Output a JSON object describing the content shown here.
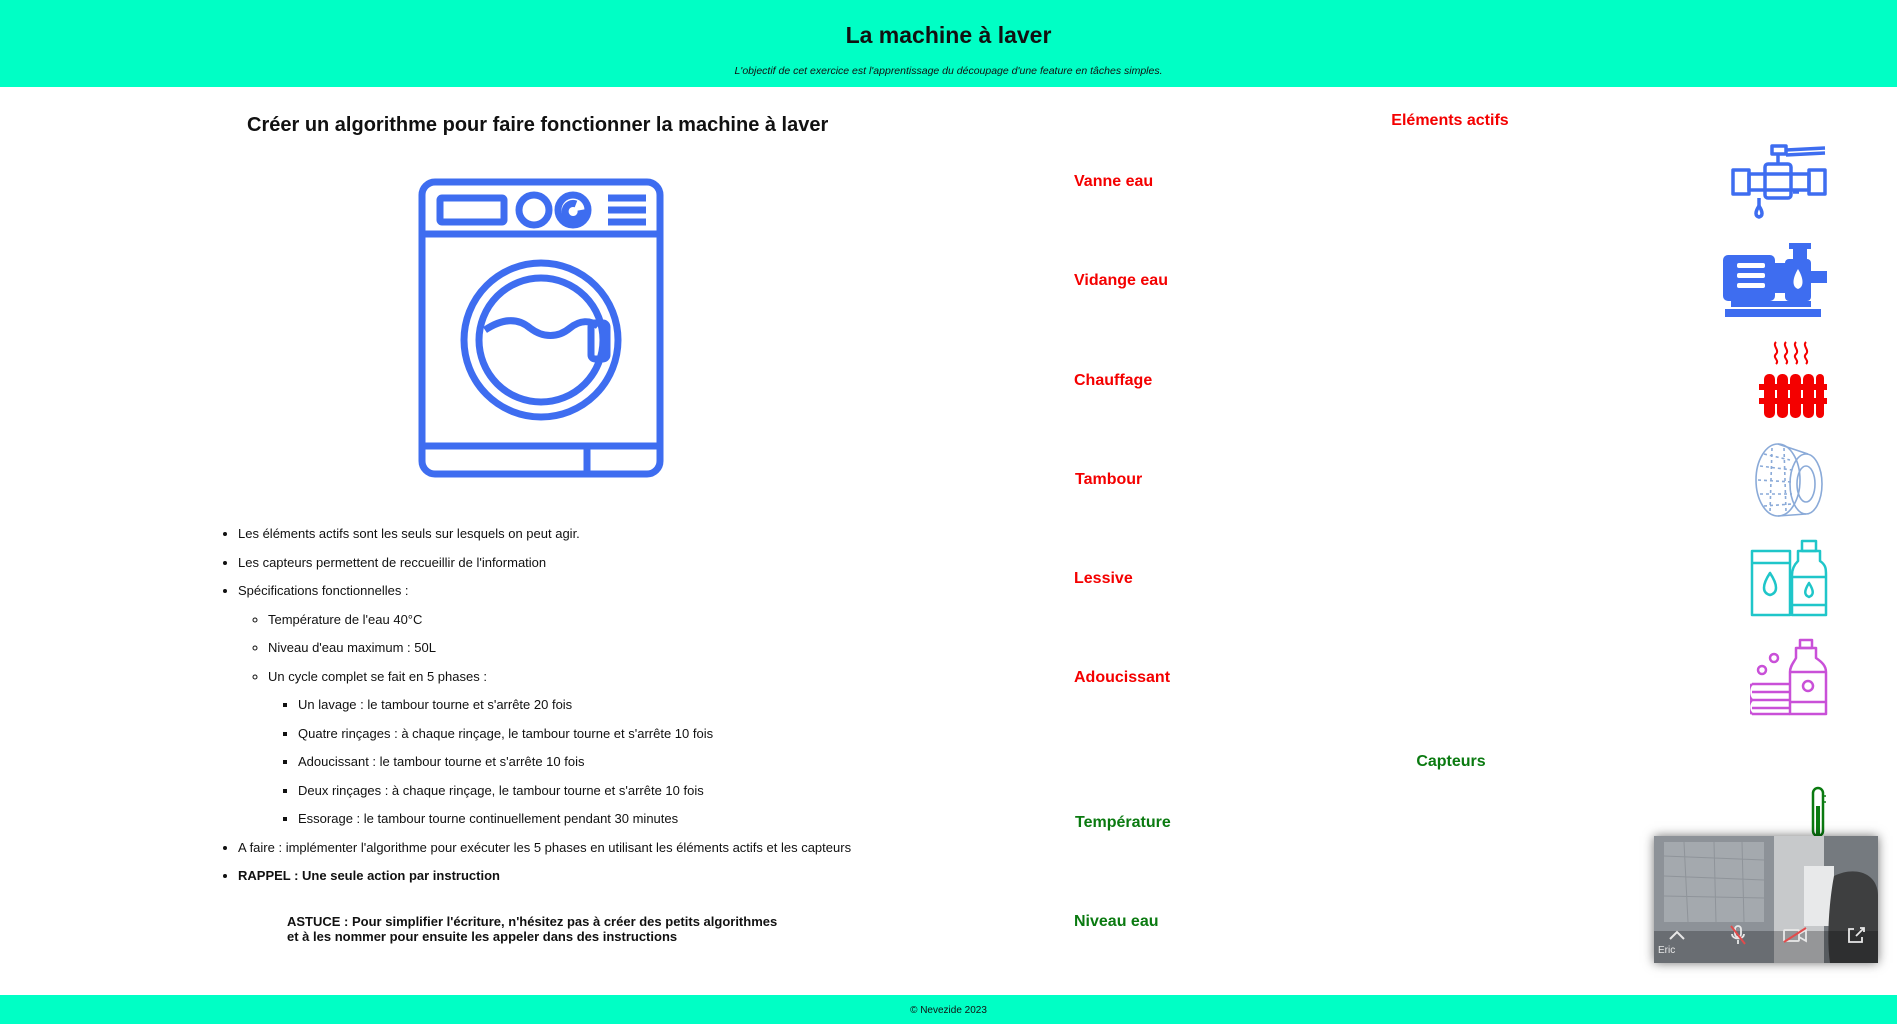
{
  "header": {
    "title": "La machine à laver",
    "subtitle": "L'objectif de cet exercice est l'apprentissage du découpage d'une feature en tâches simples."
  },
  "main": {
    "title": "Créer un algorithme pour faire fonctionner la machine à laver",
    "notes": {
      "active_elements": "Les éléments actifs sont les seuls sur lesquels on peut agir.",
      "sensors": "Les capteurs permettent de reccueillir de l'information",
      "specs": "Spécifications fonctionnelles :",
      "temperature": "Température de l'eau 40°C",
      "water_level": "Niveau d'eau maximum : 50L",
      "cycle": "Un cycle complet se fait en 5 phases :",
      "phases": [
        "Un lavage : le tambour tourne et s'arrête 20 fois",
        "Quatre rinçages : à chaque rinçage, le tambour tourne et s'arrête 10 fois",
        "Adoucissant : le tambour tourne et s'arrête 10 fois",
        "Deux rinçages : à chaque rinçage, le tambour tourne et s'arrête 10 fois",
        "Essorage : le tambour tourne continuellement pendant 30 minutes"
      ],
      "todo": "A faire : implémenter l'algorithme pour exécuter les 5 phases en utilisant les éléments actifs et les capteurs",
      "reminder": "RAPPEL : Une seule action par instruction"
    },
    "tip_line1": "ASTUCE : Pour simplifier l'écriture, n'hésitez pas à créer des petits algorithmes",
    "tip_line2": "et à les nommer pour ensuite les appeler dans des instructions"
  },
  "active_elements": {
    "heading": "Eléments actifs",
    "items": [
      {
        "label": "Vanne eau",
        "icon": "water-valve-icon"
      },
      {
        "label": "Vidange eau",
        "icon": "water-pump-icon"
      },
      {
        "label": "Chauffage",
        "icon": "radiator-icon"
      },
      {
        "label": "Tambour",
        "icon": "drum-icon"
      },
      {
        "label": "Lessive",
        "icon": "detergent-icon"
      },
      {
        "label": "Adoucissant",
        "icon": "softener-icon"
      }
    ]
  },
  "sensors": {
    "heading": "Capteurs",
    "items": [
      {
        "label": "Température",
        "icon": "thermometer-icon"
      },
      {
        "label": "Niveau eau",
        "icon": "water-level-icon"
      }
    ]
  },
  "footer": {
    "text": "© Nevezide 2023"
  },
  "video_call": {
    "participant": "Eric"
  },
  "colors": {
    "accent": "#00ffc5",
    "active_label": "#f40000",
    "sensor_label": "#0a7a10",
    "machine_icon": "#3e6df0"
  }
}
